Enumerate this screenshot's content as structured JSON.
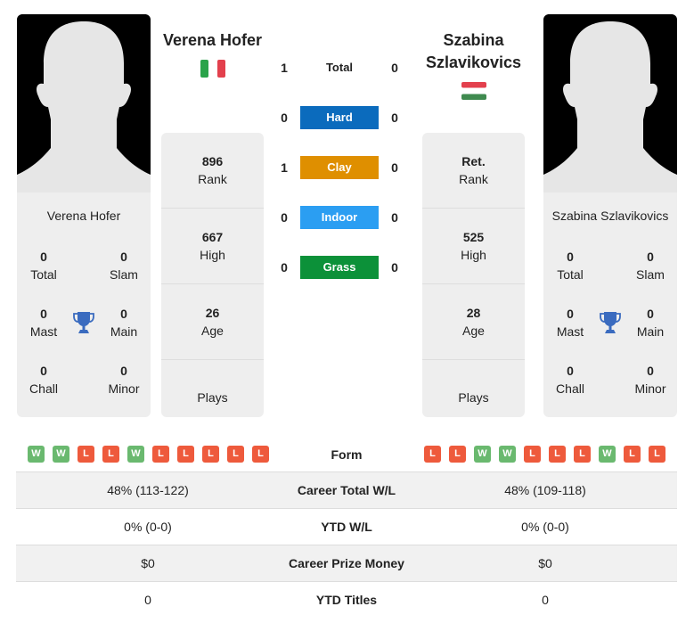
{
  "colors": {
    "win": "#6ab96f",
    "loss": "#ee5a3c",
    "hard": "#0b6bbd",
    "clay": "#df8f00",
    "indoor": "#2b9ef2",
    "grass": "#0c9139",
    "trophy": "#3a6bbf",
    "panel_bg": "#eeeeee"
  },
  "player1": {
    "name": "Verena Hofer",
    "flag": "italy-flag",
    "card": {
      "name": "Verena Hofer",
      "titles": [
        {
          "value": "0",
          "label": "Total"
        },
        {
          "value": "0",
          "label": "Slam"
        },
        {
          "value": "0",
          "label": "Mast"
        },
        {
          "value": "0",
          "label": "Main"
        },
        {
          "value": "0",
          "label": "Chall"
        },
        {
          "value": "0",
          "label": "Minor"
        }
      ]
    },
    "stats": {
      "rank": {
        "value": "896",
        "label": "Rank"
      },
      "high": {
        "value": "667",
        "label": "High"
      },
      "age": {
        "value": "26",
        "label": "Age"
      },
      "plays": {
        "label": "Plays"
      }
    },
    "form": [
      "W",
      "W",
      "L",
      "L",
      "W",
      "L",
      "L",
      "L",
      "L",
      "L"
    ]
  },
  "player2": {
    "name_line1": "Szabina",
    "name_line2": "Szlavikovics",
    "flag": "hungary-flag",
    "card": {
      "name": "Szabina Szlavikovics",
      "titles": [
        {
          "value": "0",
          "label": "Total"
        },
        {
          "value": "0",
          "label": "Slam"
        },
        {
          "value": "0",
          "label": "Mast"
        },
        {
          "value": "0",
          "label": "Main"
        },
        {
          "value": "0",
          "label": "Chall"
        },
        {
          "value": "0",
          "label": "Minor"
        }
      ]
    },
    "stats": {
      "rank": {
        "value": "Ret.",
        "label": "Rank"
      },
      "high": {
        "value": "525",
        "label": "High"
      },
      "age": {
        "value": "28",
        "label": "Age"
      },
      "plays": {
        "label": "Plays"
      }
    },
    "form": [
      "L",
      "L",
      "W",
      "W",
      "L",
      "L",
      "L",
      "W",
      "L",
      "L"
    ]
  },
  "h2h": [
    {
      "surface": "Total",
      "p1": "1",
      "p2": "0",
      "style": "plain"
    },
    {
      "surface": "Hard",
      "p1": "0",
      "p2": "0",
      "style": "hard"
    },
    {
      "surface": "Clay",
      "p1": "1",
      "p2": "0",
      "style": "clay"
    },
    {
      "surface": "Indoor",
      "p1": "0",
      "p2": "0",
      "style": "indoor"
    },
    {
      "surface": "Grass",
      "p1": "0",
      "p2": "0",
      "style": "grass"
    }
  ],
  "form_label": "Form",
  "comparison": [
    {
      "label": "Career Total W/L",
      "p1": "48% (113-122)",
      "p2": "48% (109-118)"
    },
    {
      "label": "YTD W/L",
      "p1": "0% (0-0)",
      "p2": "0% (0-0)"
    },
    {
      "label": "Career Prize Money",
      "p1": "$0",
      "p2": "$0"
    },
    {
      "label": "YTD Titles",
      "p1": "0",
      "p2": "0"
    }
  ]
}
